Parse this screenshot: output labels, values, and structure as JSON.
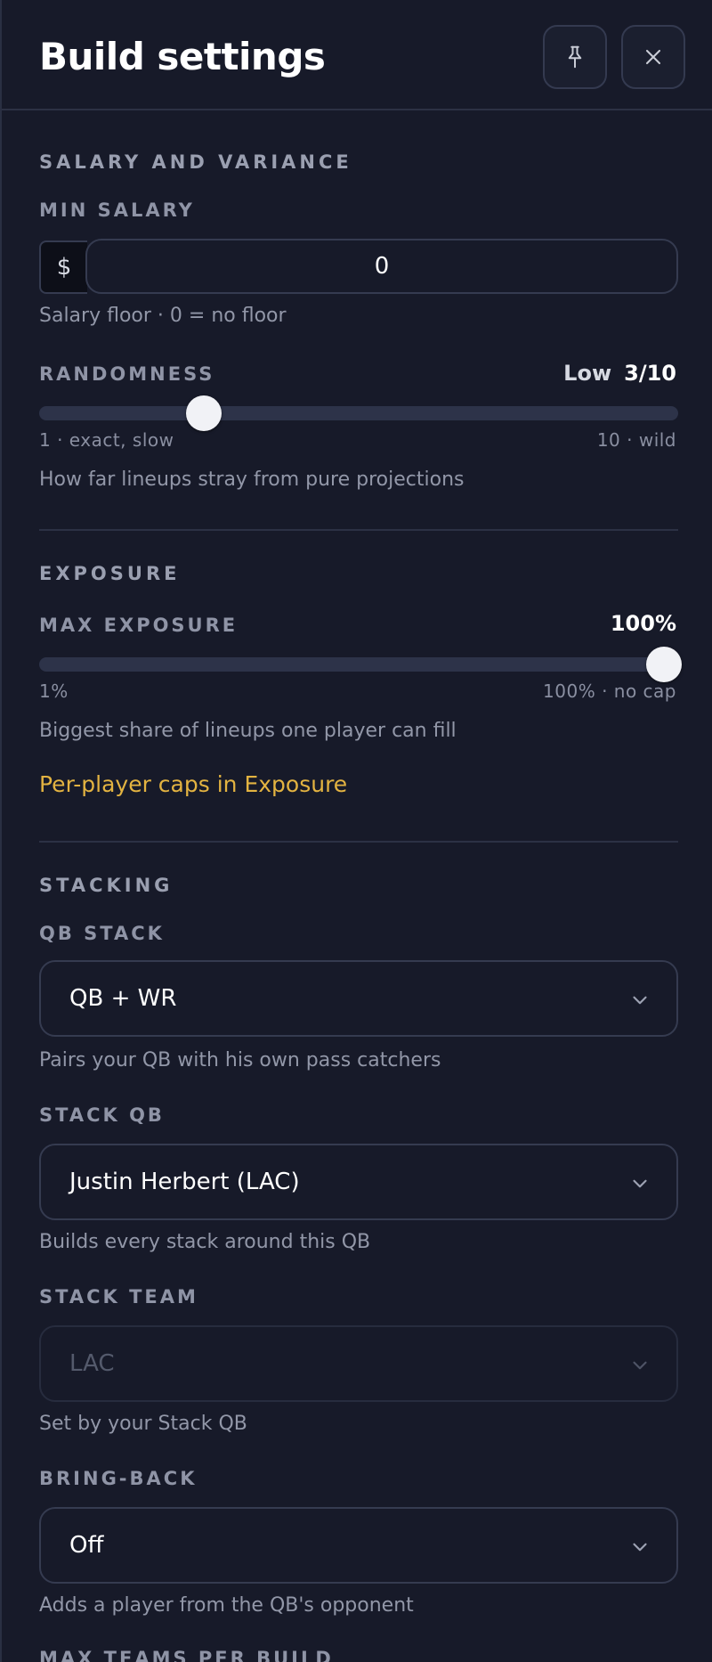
{
  "header": {
    "title": "Build settings",
    "pin_icon": "pin-icon",
    "close_icon": "close-icon"
  },
  "salary_variance": {
    "section_title": "SALARY AND VARIANCE",
    "min_salary": {
      "label": "MIN SALARY",
      "prefix": "$",
      "value": "0",
      "help": "Salary floor · 0 = no floor"
    },
    "randomness": {
      "label": "RANDOMNESS",
      "level_text": "Low",
      "value_text": "3/10",
      "value": 3,
      "min": 1,
      "max": 10,
      "min_label": "1 · exact, slow",
      "max_label": "10 · wild",
      "help": "How far lineups stray from pure projections"
    }
  },
  "exposure": {
    "section_title": "EXPOSURE",
    "max_exposure": {
      "label": "MAX EXPOSURE",
      "value_text": "100%",
      "value": 100,
      "min": 1,
      "max": 100,
      "min_label": "1%",
      "max_label": "100% · no cap",
      "help": "Biggest share of lineups one player can fill"
    },
    "link_text": "Per-player caps in Exposure"
  },
  "stacking": {
    "section_title": "STACKING",
    "qb_stack": {
      "label": "QB STACK",
      "value": "QB + WR",
      "help": "Pairs your QB with his own pass catchers"
    },
    "stack_qb": {
      "label": "STACK QB",
      "value": "Justin Herbert (LAC)",
      "help": "Builds every stack around this QB"
    },
    "stack_team": {
      "label": "STACK TEAM",
      "value": "LAC",
      "help": "Set by your Stack QB",
      "disabled": true
    },
    "bring_back": {
      "label": "BRING-BACK",
      "value": "Off",
      "help": "Adds a player from the QB's opponent"
    },
    "max_teams_label": "MAX TEAMS PER BUILD"
  },
  "colors": {
    "background": "#171a29",
    "accent_link": "#e3b341",
    "slider_track": "#2d3349",
    "slider_thumb": "#f1f2f6"
  }
}
